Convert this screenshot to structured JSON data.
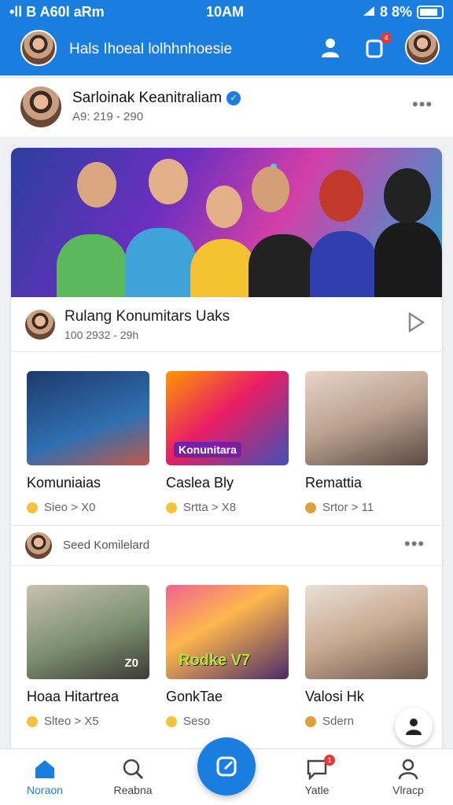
{
  "status_bar": {
    "left": "•ll B A60l aRm",
    "time": "10AM",
    "battery": "8 8%"
  },
  "header": {
    "title": "Hals Ihoeal lolhhnhoesie",
    "notification_count": "4"
  },
  "profile": {
    "name": "Sarloinak Keanitraliam",
    "subtitle": "A9: 219 - 290"
  },
  "post": {
    "title": "Rulang Konumitars Uaks",
    "subtitle": "100 2932 - 29h"
  },
  "row1": [
    {
      "name": "Komuniaias",
      "meta": "Sieo > X0",
      "thumb_label": ""
    },
    {
      "name": "Caslea Bly",
      "meta": "Srtta > X8",
      "thumb_label": "Konunitara"
    },
    {
      "name": "Remattia",
      "meta": "Srtor > 11",
      "thumb_label": ""
    }
  ],
  "seed": {
    "label": "Seed Komilelard"
  },
  "row2": [
    {
      "name": "Hoaa Hitartrea",
      "meta": "Slteo > X5",
      "thumb_label": "Z0"
    },
    {
      "name": "GonkTae",
      "meta": "Seso",
      "thumb_label": "Rodke V7"
    },
    {
      "name": "Valosi Hk",
      "meta": "Sdern",
      "thumb_label": ""
    }
  ],
  "nav": [
    {
      "label": "Noraon",
      "icon": "home-icon"
    },
    {
      "label": "Reabna",
      "icon": "search-icon"
    },
    {
      "label": "Yatle",
      "icon": "chat-icon"
    },
    {
      "label": "Vlracp",
      "icon": "profile-icon"
    }
  ],
  "nav_badge": "1",
  "colors": {
    "primary": "#1a7ee0",
    "badge": "#e53935"
  }
}
